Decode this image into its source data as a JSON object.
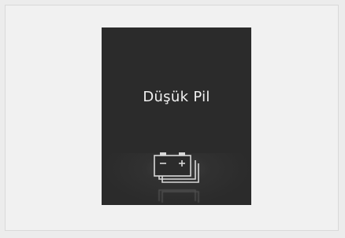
{
  "screen": {
    "title": "Düşük Pil"
  },
  "icon": {
    "name": "low-battery-icon",
    "minus_sign": "−",
    "plus_sign": "+"
  },
  "colors": {
    "background": "#ececec",
    "panel": "#2b2b2b",
    "text": "#f2f2f2",
    "icon_stroke": "#d8d8d8"
  }
}
